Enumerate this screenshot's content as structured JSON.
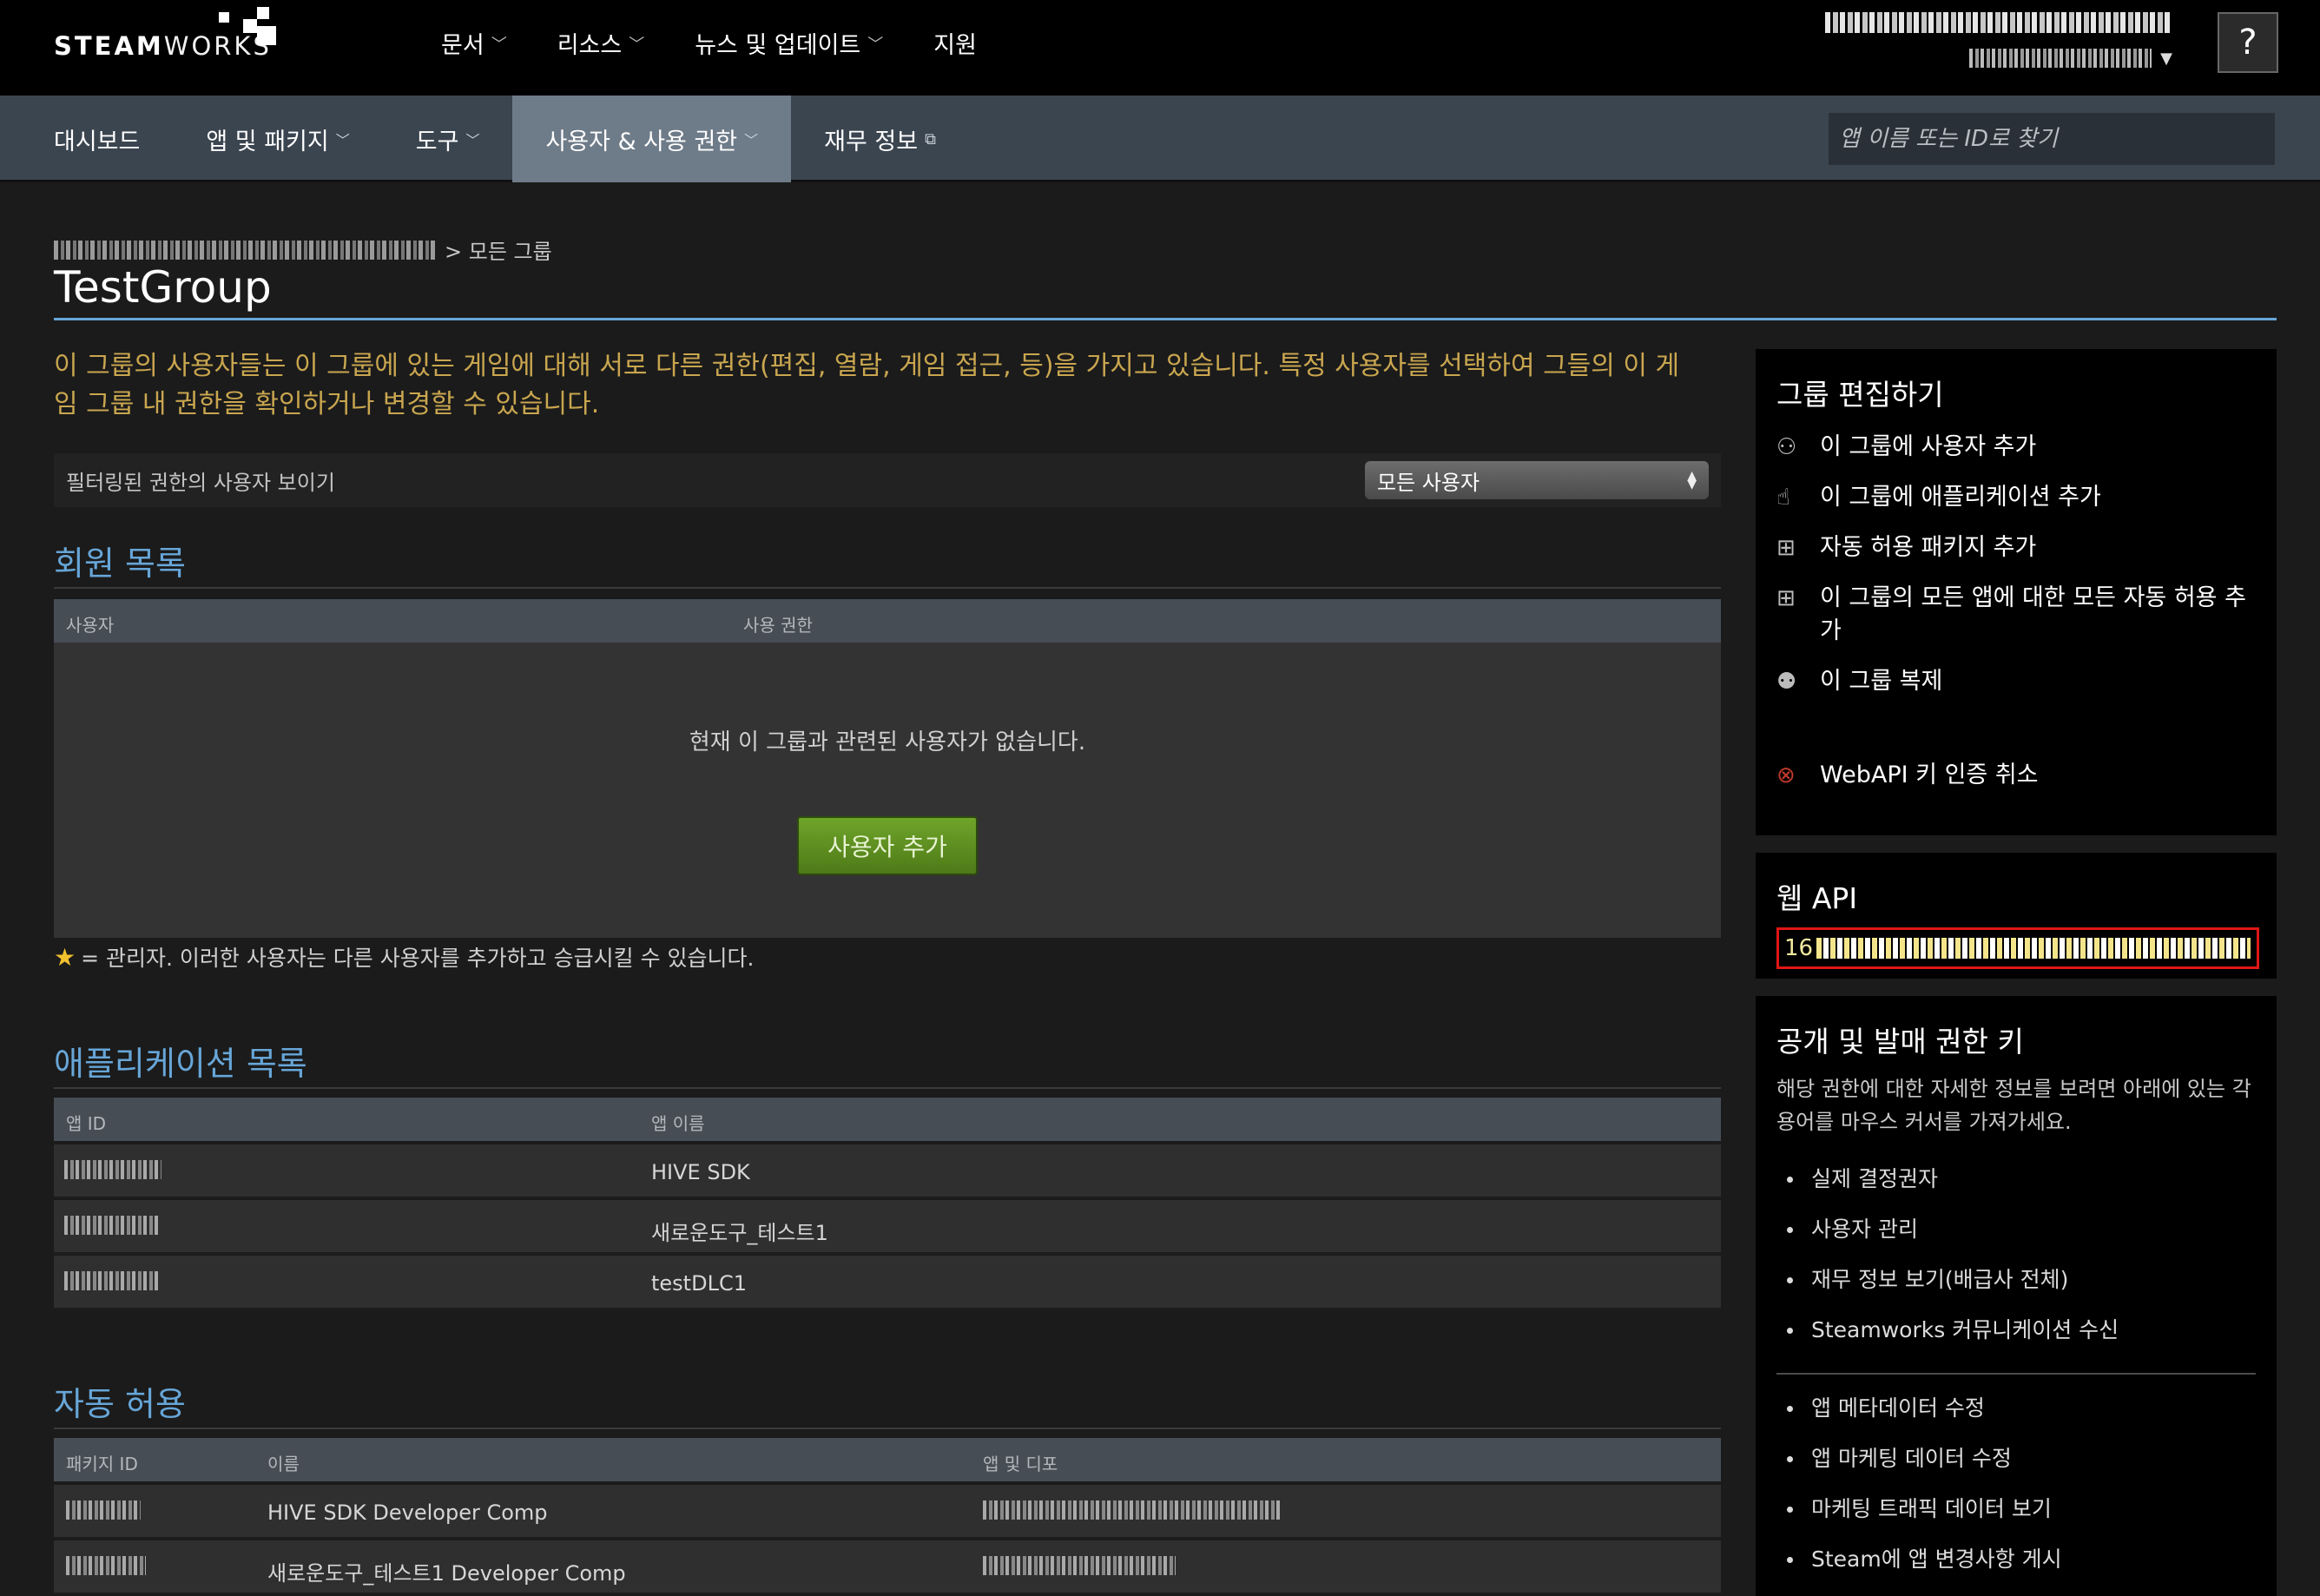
{
  "logo": {
    "text_bold": "STEAM",
    "text_light": "WORKS"
  },
  "top_nav": [
    {
      "label": "문서",
      "has_menu": true
    },
    {
      "label": "리소스",
      "has_menu": true
    },
    {
      "label": "뉴스 및 업데이트",
      "has_menu": true
    },
    {
      "label": "지원",
      "has_menu": false
    }
  ],
  "help_label": "?",
  "sub_nav": [
    {
      "label": "대시보드",
      "has_menu": false
    },
    {
      "label": "앱 및 패키지",
      "has_menu": true
    },
    {
      "label": "도구",
      "has_menu": true
    },
    {
      "label": "사용자 & 사용 권한",
      "has_menu": true,
      "active": true
    },
    {
      "label": "재무 정보",
      "external": true
    }
  ],
  "search": {
    "placeholder": "앱 이름 또는 ID로 찾기"
  },
  "breadcrumb": {
    "current": "> 모든 그룹"
  },
  "page_title": "TestGroup",
  "intro": "이 그룹의 사용자들는 이 그룹에 있는 게임에 대해 서로 다른 권한(편집, 열람, 게임 접근, 등)을 가지고 있습니다. 특정 사용자를 선택하여 그들의 이 게임 그룹 내 권한을 확인하거나 변경할 수 있습니다.",
  "filter": {
    "label": "필터링된 권한의 사용자 보이기",
    "selected": "모든 사용자"
  },
  "members": {
    "title": "회원 목록",
    "col_user": "사용자",
    "col_perm": "사용 권한",
    "empty": "현재 이 그룹과 관련된 사용자가 없습니다.",
    "add_button": "사용자 추가",
    "admin_note": "= 관리자. 이러한 사용자는 다른 사용자를 추가하고 승급시킬 수 있습니다."
  },
  "apps": {
    "title": "애플리케이션 목록",
    "col_id": "앱 ID",
    "col_name": "앱 이름",
    "rows": [
      {
        "name": "HIVE SDK"
      },
      {
        "name": "새로운도구_테스트1"
      },
      {
        "name": "testDLC1"
      }
    ]
  },
  "auto_grant": {
    "title": "자동 허용",
    "col_pkg": "패키지 ID",
    "col_name": "이름",
    "col_apps": "앱 및 디포",
    "rows": [
      {
        "name": "HIVE SDK Developer Comp"
      },
      {
        "name": "새로운도구_테스트1 Developer Comp"
      }
    ]
  },
  "edit_panel": {
    "title": "그룹 편집하기",
    "items": [
      {
        "icon": "user-add-icon",
        "glyph": "⚇",
        "label": "이 그룹에 사용자 추가"
      },
      {
        "icon": "app-add-icon",
        "glyph": "☝",
        "label": "이 그룹에 애플리케이션 추가"
      },
      {
        "icon": "package-icon",
        "glyph": "⊞",
        "label": "자동 허용 패키지 추가"
      },
      {
        "icon": "package-all-icon",
        "glyph": "⊞",
        "label": "이 그룹의 모든 앱에 대한 모든 자동 허용 추가"
      },
      {
        "icon": "copy-group-icon",
        "glyph": "⚉",
        "label": "이 그룹 복제"
      }
    ],
    "revoke": {
      "icon": "revoke-icon",
      "glyph": "⊗",
      "label": "WebAPI 키 인증 취소"
    }
  },
  "api_panel": {
    "title": "웹 API",
    "key_prefix": "16"
  },
  "perm_panel": {
    "title": "공개 및 발매 권한 키",
    "desc": "해당 권한에 대한 자세한 정보를 보려면 아래에 있는 각 용어를 마우스 커서를 가져가세요.",
    "group1": [
      "실제 결정권자",
      "사용자 관리",
      "재무 정보 보기(배급사 전체)",
      "Steamworks 커뮤니케이션 수신"
    ],
    "group2": [
      "앱 메타데이터 수정",
      "앱 마케팅 데이터 수정",
      "마케팅 트래픽 데이터 보기",
      "Steam에 앱 변경사항 게시"
    ]
  },
  "colors": {
    "accent": "#67a6d8",
    "intro_text": "#c9a64f",
    "button_green": "#5f8f22",
    "highlight_red": "#e01616"
  }
}
